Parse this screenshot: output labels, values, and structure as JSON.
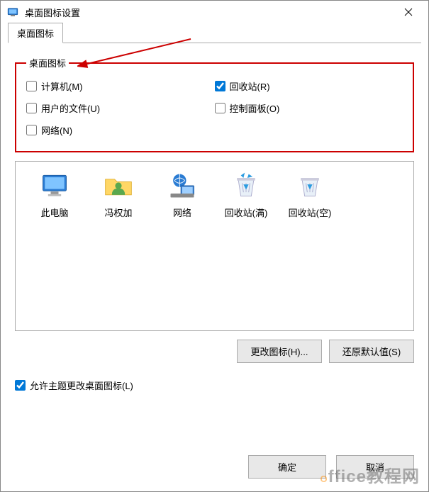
{
  "window": {
    "title": "桌面图标设置"
  },
  "tab": {
    "label": "桌面图标"
  },
  "group": {
    "legend": "桌面图标",
    "items": {
      "computer": {
        "label": "计算机(M)",
        "checked": false
      },
      "recycle": {
        "label": "回收站(R)",
        "checked": true
      },
      "userfiles": {
        "label": "用户的文件(U)",
        "checked": false
      },
      "controlpanel": {
        "label": "控制面板(O)",
        "checked": false
      },
      "network": {
        "label": "网络(N)",
        "checked": false
      }
    }
  },
  "preview": {
    "items": [
      {
        "id": "thispc",
        "label": "此电脑"
      },
      {
        "id": "userfolder",
        "label": "冯权加"
      },
      {
        "id": "network",
        "label": "网络"
      },
      {
        "id": "recyclefull",
        "label": "回收站(满)"
      },
      {
        "id": "recycleempty",
        "label": "回收站(空)"
      }
    ]
  },
  "buttons": {
    "change_icon": "更改图标(H)...",
    "restore_default": "还原默认值(S)",
    "ok": "确定",
    "cancel": "取消"
  },
  "allow_theme": {
    "label": "允许主题更改桌面图标(L)",
    "checked": true
  },
  "watermark": "Office教程网"
}
